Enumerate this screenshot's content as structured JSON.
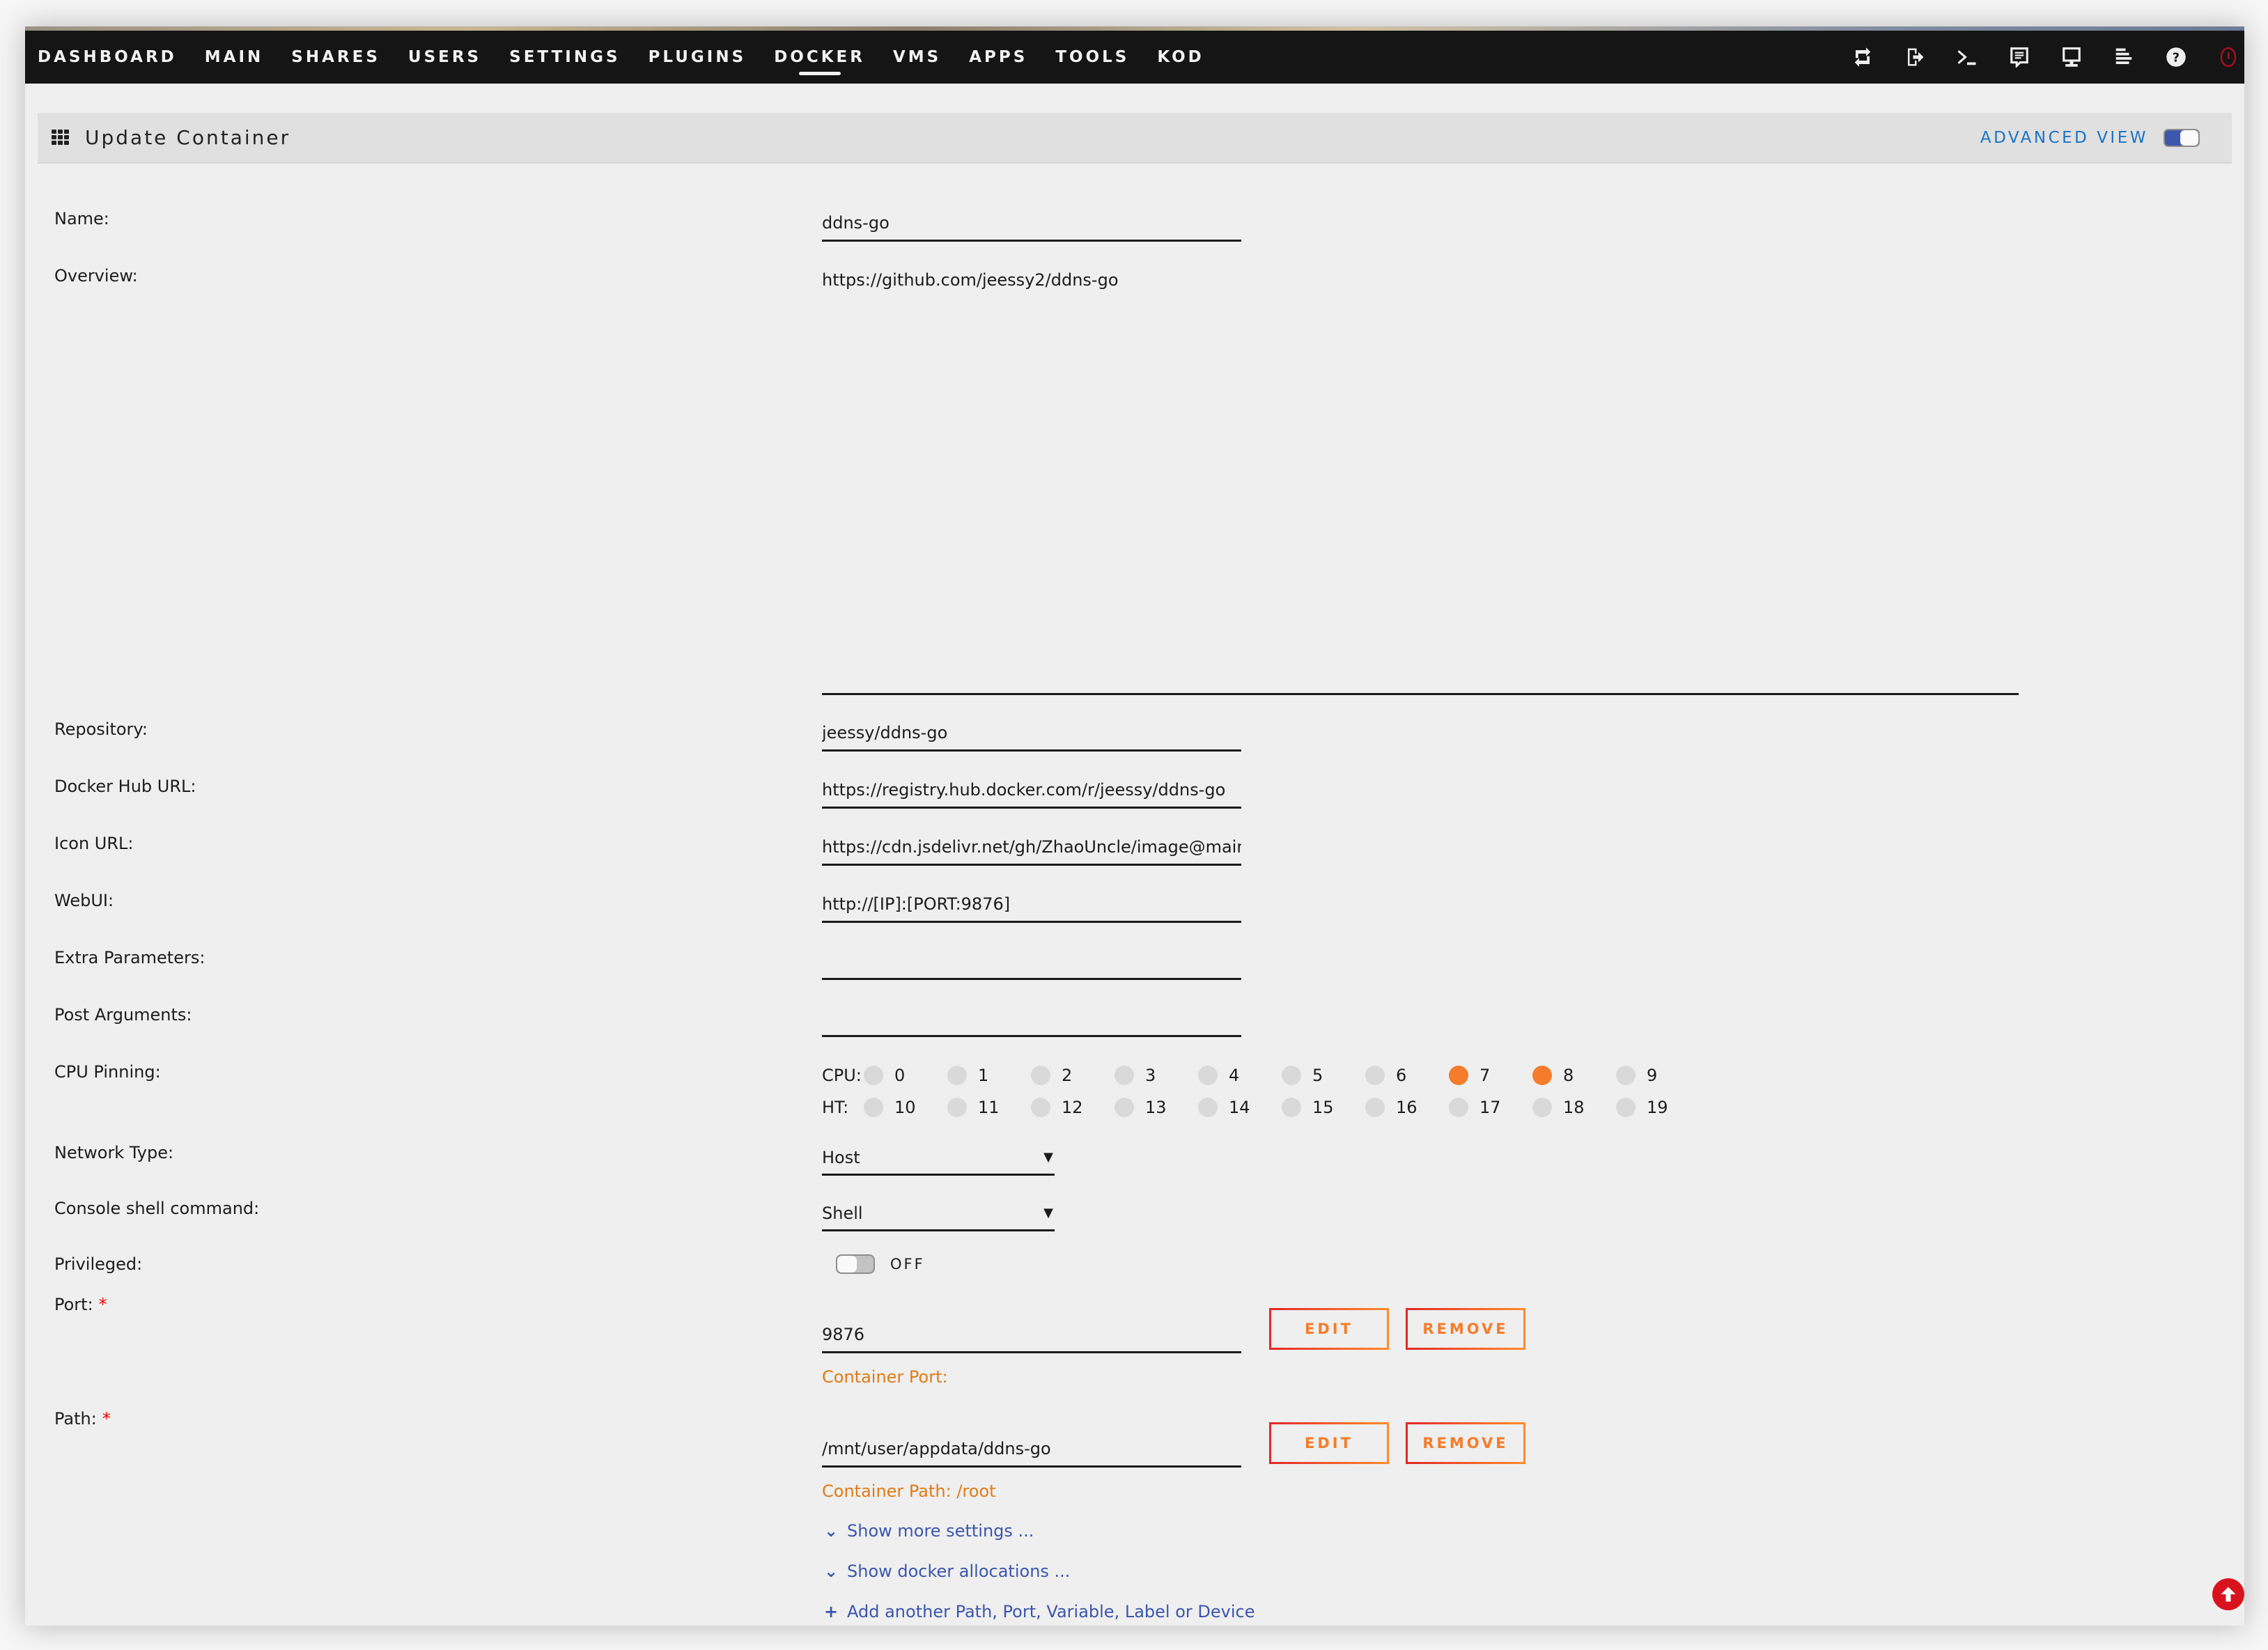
{
  "nav": {
    "items": [
      {
        "label": "DASHBOARD",
        "active": false
      },
      {
        "label": "MAIN",
        "active": false
      },
      {
        "label": "SHARES",
        "active": false
      },
      {
        "label": "USERS",
        "active": false
      },
      {
        "label": "SETTINGS",
        "active": false
      },
      {
        "label": "PLUGINS",
        "active": false
      },
      {
        "label": "DOCKER",
        "active": true
      },
      {
        "label": "VMS",
        "active": false
      },
      {
        "label": "APPS",
        "active": false
      },
      {
        "label": "TOOLS",
        "active": false
      },
      {
        "label": "KOD",
        "active": false
      }
    ],
    "icons": [
      "switch-language-icon",
      "logout-icon",
      "terminal-icon",
      "feedback-icon",
      "monitor-icon",
      "log-icon",
      "help-icon",
      "power-icon"
    ]
  },
  "header": {
    "title": "Update Container",
    "advanced_view_label": "ADVANCED VIEW",
    "advanced_view_on": true
  },
  "form": {
    "name": {
      "label": "Name:",
      "value": "ddns-go"
    },
    "overview": {
      "label": "Overview:",
      "value": "https://github.com/jeessy2/ddns-go"
    },
    "repository": {
      "label": "Repository:",
      "value": "jeessy/ddns-go"
    },
    "docker_hub_url": {
      "label": "Docker Hub URL:",
      "value": "https://registry.hub.docker.com/r/jeessy/ddns-go"
    },
    "icon_url": {
      "label": "Icon URL:",
      "value": "https://cdn.jsdelivr.net/gh/ZhaoUncle/image@main"
    },
    "webui": {
      "label": "WebUI:",
      "value": "http://[IP]:[PORT:9876]"
    },
    "extra_parameters": {
      "label": "Extra Parameters:",
      "value": ""
    },
    "post_arguments": {
      "label": "Post Arguments:",
      "value": ""
    },
    "cpu_pinning": {
      "label": "CPU Pinning:",
      "cpu_label": "CPU:",
      "ht_label": "HT:",
      "cpu": [
        {
          "n": "0",
          "on": false
        },
        {
          "n": "1",
          "on": false
        },
        {
          "n": "2",
          "on": false
        },
        {
          "n": "3",
          "on": false
        },
        {
          "n": "4",
          "on": false
        },
        {
          "n": "5",
          "on": false
        },
        {
          "n": "6",
          "on": false
        },
        {
          "n": "7",
          "on": true
        },
        {
          "n": "8",
          "on": true
        },
        {
          "n": "9",
          "on": false
        }
      ],
      "ht": [
        {
          "n": "10",
          "on": false
        },
        {
          "n": "11",
          "on": false
        },
        {
          "n": "12",
          "on": false
        },
        {
          "n": "13",
          "on": false
        },
        {
          "n": "14",
          "on": false
        },
        {
          "n": "15",
          "on": false
        },
        {
          "n": "16",
          "on": false
        },
        {
          "n": "17",
          "on": false
        },
        {
          "n": "18",
          "on": false
        },
        {
          "n": "19",
          "on": false
        }
      ]
    },
    "network_type": {
      "label": "Network Type:",
      "value": "Host"
    },
    "console_shell": {
      "label": "Console shell command:",
      "value": "Shell"
    },
    "privileged": {
      "label": "Privileged:",
      "state_label": "OFF",
      "on": false
    },
    "port": {
      "label": "Port:",
      "required": "*",
      "value": "9876",
      "hint": "Container Port:",
      "edit_label": "EDIT",
      "remove_label": "REMOVE"
    },
    "path": {
      "label": "Path:",
      "required": "*",
      "value": "/mnt/user/appdata/ddns-go",
      "hint": "Container Path: /root",
      "edit_label": "EDIT",
      "remove_label": "REMOVE"
    }
  },
  "links": {
    "show_more": "Show more settings ...",
    "show_allocations": "Show docker allocations ...",
    "add_another": "Add another Path, Port, Variable, Label or Device"
  },
  "colors": {
    "nav_bg": "#151515",
    "accent_orange": "#f57c2a",
    "accent_red": "#e22828",
    "link_blue": "#3b56ad",
    "advanced_blue": "#1a73c4",
    "scroll_top_red": "#d9131e"
  }
}
